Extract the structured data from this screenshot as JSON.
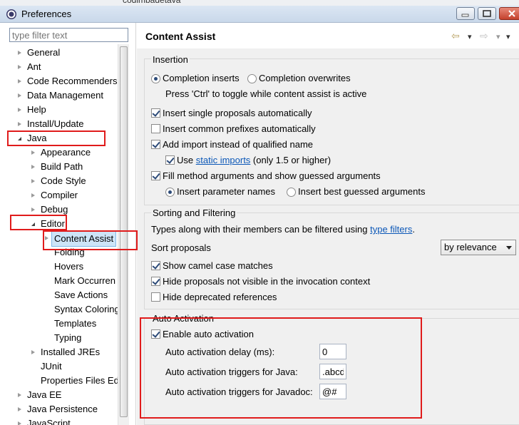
{
  "background_window": {
    "title": "codimbadetava"
  },
  "window": {
    "title": "Preferences",
    "minimize": "—",
    "maximize": "□",
    "close": "✕"
  },
  "filter": {
    "placeholder": "type filter text"
  },
  "tree": {
    "items": [
      {
        "label": "General",
        "depth": 0,
        "state": "collapsed"
      },
      {
        "label": "Ant",
        "depth": 0,
        "state": "collapsed"
      },
      {
        "label": "Code Recommenders",
        "depth": 0,
        "state": "collapsed"
      },
      {
        "label": "Data Management",
        "depth": 0,
        "state": "collapsed"
      },
      {
        "label": "Help",
        "depth": 0,
        "state": "collapsed"
      },
      {
        "label": "Install/Update",
        "depth": 0,
        "state": "collapsed"
      },
      {
        "label": "Java",
        "depth": 0,
        "state": "expanded"
      },
      {
        "label": "Appearance",
        "depth": 1,
        "state": "collapsed"
      },
      {
        "label": "Build Path",
        "depth": 1,
        "state": "collapsed"
      },
      {
        "label": "Code Style",
        "depth": 1,
        "state": "collapsed"
      },
      {
        "label": "Compiler",
        "depth": 1,
        "state": "collapsed"
      },
      {
        "label": "Debug",
        "depth": 1,
        "state": "collapsed"
      },
      {
        "label": "Editor",
        "depth": 1,
        "state": "expanded"
      },
      {
        "label": "Content Assist",
        "depth": 2,
        "state": "collapsed",
        "selected": true
      },
      {
        "label": "Folding",
        "depth": 2,
        "state": "leaf"
      },
      {
        "label": "Hovers",
        "depth": 2,
        "state": "leaf"
      },
      {
        "label": "Mark Occurren",
        "depth": 2,
        "state": "leaf"
      },
      {
        "label": "Save Actions",
        "depth": 2,
        "state": "leaf"
      },
      {
        "label": "Syntax Coloring",
        "depth": 2,
        "state": "leaf"
      },
      {
        "label": "Templates",
        "depth": 2,
        "state": "leaf"
      },
      {
        "label": "Typing",
        "depth": 2,
        "state": "leaf"
      },
      {
        "label": "Installed JREs",
        "depth": 1,
        "state": "collapsed"
      },
      {
        "label": "JUnit",
        "depth": 1,
        "state": "leaf"
      },
      {
        "label": "Properties Files Ed",
        "depth": 1,
        "state": "leaf"
      },
      {
        "label": "Java EE",
        "depth": 0,
        "state": "collapsed"
      },
      {
        "label": "Java Persistence",
        "depth": 0,
        "state": "collapsed"
      },
      {
        "label": "JavaScript",
        "depth": 0,
        "state": "collapsed"
      }
    ]
  },
  "page": {
    "title": "Content Assist",
    "nav_back": "⇦",
    "nav_forward": "⇨",
    "menu_glyph": "▾"
  },
  "insertion": {
    "title": "Insertion",
    "radio_inserts": {
      "label": "Completion inserts",
      "checked": true
    },
    "radio_overwrites": {
      "label": "Completion overwrites",
      "checked": false
    },
    "toggle_hint": "Press 'Ctrl' to toggle while content assist is active",
    "single_proposals": {
      "label": "Insert single proposals automatically",
      "checked": true
    },
    "common_prefixes": {
      "label": "Insert common prefixes automatically",
      "checked": false
    },
    "add_import": {
      "label": "Add import instead of qualified name",
      "checked": true
    },
    "use_static": {
      "prefix": "Use ",
      "link": "static imports",
      "suffix": " (only 1.5 or higher)",
      "checked": true
    },
    "fill_args": {
      "label": "Fill method arguments and show guessed arguments",
      "checked": true
    },
    "radio_param_names": {
      "label": "Insert parameter names",
      "checked": true
    },
    "radio_best_guess": {
      "label": "Insert best guessed arguments",
      "checked": false
    }
  },
  "sorting": {
    "title": "Sorting and Filtering",
    "desc_prefix": "Types along with their members can be filtered using ",
    "desc_link": "type filters",
    "desc_suffix": ".",
    "sort_label": "Sort proposals",
    "sort_value": "by relevance",
    "camel_case": {
      "label": "Show camel case matches",
      "checked": true
    },
    "hide_not_visible": {
      "label": "Hide proposals not visible in the invocation context",
      "checked": true
    },
    "hide_deprecated": {
      "label": "Hide deprecated references",
      "checked": false
    }
  },
  "auto_activation": {
    "title": "Auto Activation",
    "enable": {
      "label": "Enable auto activation",
      "checked": true
    },
    "delay_label": "Auto activation delay (ms):",
    "delay_value": "0",
    "java_label": "Auto activation triggers for Java:",
    "java_value": ".abcd",
    "javadoc_label": "Auto activation triggers for Javadoc:",
    "javadoc_value": "@#"
  },
  "colors": {
    "annotation_red": "#e01b1b",
    "selection": "#cde4f7",
    "link": "#0b57b7"
  }
}
